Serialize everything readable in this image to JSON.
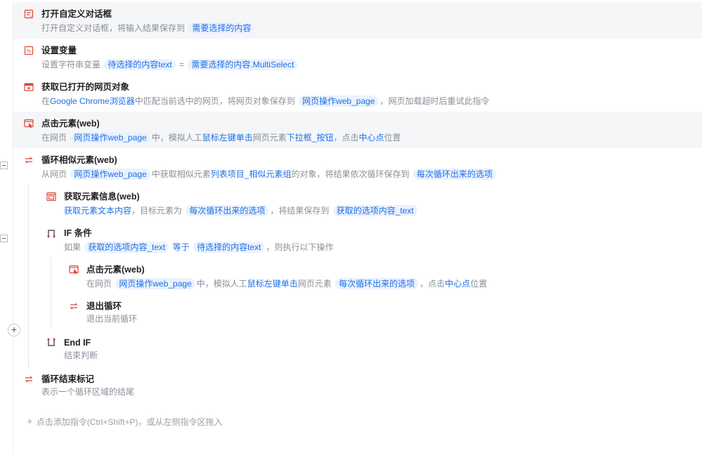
{
  "colors": {
    "link": "#1f6fe5",
    "tag_bg": "#eaf2fe",
    "highlight_row": "#f5f6f8",
    "desc": "#8a8f99",
    "icon_red": "#e0463a"
  },
  "steps": [
    {
      "title": "打开自定义对话框",
      "icon": "dialog-icon",
      "desc": {
        "t1": "打开自定义对话框，将输入结果保存到",
        "tag1": "需要选择的内容"
      }
    },
    {
      "title": "设置变量",
      "icon": "variable-icon",
      "desc": {
        "t1": "设置字符串变量",
        "tag1": "待选择的内容text",
        "eq": "=",
        "tag2": "需要选择的内容.MultiSelect"
      }
    },
    {
      "title": "获取已打开的网页对象",
      "icon": "browser-icon",
      "desc": {
        "t1": "在",
        "link1": "Google Chrome浏览器",
        "t2": "中匹配当前选中的网页，将网页对象保存到",
        "tag1": "网页操作web_page",
        "t3": "，网页加载超时后重试此指令"
      }
    },
    {
      "title": "点击元素(web)",
      "icon": "click-element-icon",
      "desc": {
        "t1": "在网页",
        "tag1": "网页操作web_page",
        "t2": "中，模拟人工",
        "link1": "鼠标左键单击",
        "t3": "网页元素",
        "link2": "下拉框_按钮",
        "t4": "，点击",
        "link3": "中心点",
        "t5": "位置"
      }
    },
    {
      "title": "循环相似元素(web)",
      "icon": "loop-icon",
      "desc": {
        "t1": "从网页",
        "tag1": "网页操作web_page",
        "t2": "中获取相似元素",
        "link1": "列表项目_相似元素组",
        "t3": "的对象，将结果依次循环保存到",
        "tag2": "每次循环出来的选项"
      }
    },
    {
      "title": "获取元素信息(web)",
      "icon": "element-info-icon",
      "desc": {
        "link1": "获取元素文本内容",
        "t1": "，目标元素为",
        "tag1": "每次循环出来的选项",
        "t2": "，将结果保存到",
        "tag2": "获取的选项内容_text"
      }
    },
    {
      "title": "IF 条件",
      "icon": "if-icon",
      "desc": {
        "t1": "如果",
        "tag1": "获取的选项内容_text",
        "link1": "等于",
        "tag2": "待选择的内容text",
        "t2": "，则执行以下操作"
      }
    },
    {
      "title": "点击元素(web)",
      "icon": "click-element-icon",
      "desc": {
        "t1": "在网页",
        "tag1": "网页操作web_page",
        "t2": "中，模拟人工",
        "link1": "鼠标左键单击",
        "t3": "网页元素",
        "tag2": "每次循环出来的选项",
        "t4": "，点击",
        "link2": "中心点",
        "t5": "位置"
      }
    },
    {
      "title": "退出循环",
      "icon": "exit-loop-icon",
      "desc": {
        "t1": "退出当前循环"
      }
    },
    {
      "title": "End IF",
      "icon": "end-if-icon",
      "desc": {
        "t1": "结束判断"
      }
    },
    {
      "title": "循环结束标记",
      "icon": "loop-end-icon",
      "desc": {
        "t1": "表示一个循环区域的结尾"
      }
    }
  ],
  "add_command": {
    "plus": "+",
    "label": "点击添加指令(Ctrl+Shift+P)，或从左侧指令区拖入"
  }
}
